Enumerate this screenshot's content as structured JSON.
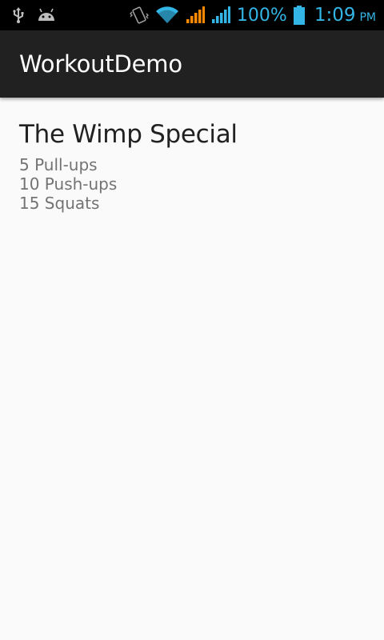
{
  "status_bar": {
    "icons_left": [
      "usb-icon",
      "android-debug-icon"
    ],
    "icons_right": [
      "vibrate-icon",
      "wifi-icon",
      "cell-signal-orange-icon",
      "cell-signal-blue-icon",
      "battery-icon"
    ],
    "battery_percent": "100%",
    "time": "1:09",
    "ampm": "PM",
    "accent_color": "#33b5e5"
  },
  "action_bar": {
    "title": "WorkoutDemo",
    "background": "#212121"
  },
  "workout": {
    "name": "The Wimp Special",
    "exercises": [
      "5 Pull-ups",
      "10 Push-ups",
      "15 Squats"
    ]
  }
}
